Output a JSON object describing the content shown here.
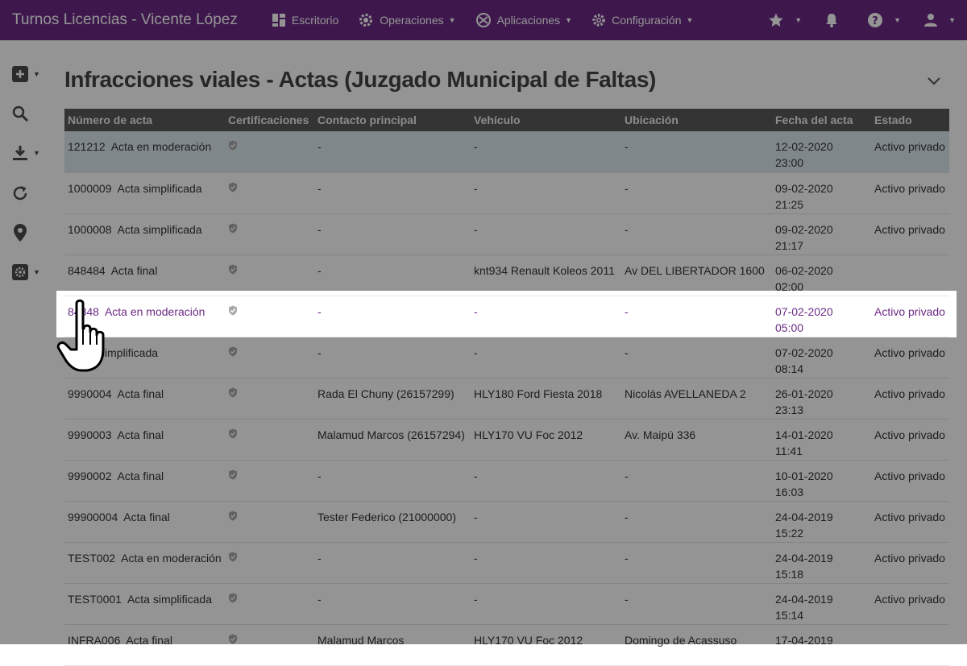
{
  "app": {
    "title": "Turnos Licencias - Vicente López",
    "nav": [
      {
        "label": "Escritorio",
        "icon": "dashboard-icon"
      },
      {
        "label": "Operaciones",
        "icon": "cog-operations-icon"
      },
      {
        "label": "Aplicaciones",
        "icon": "apps-icon"
      },
      {
        "label": "Configuración",
        "icon": "gear-icon"
      }
    ],
    "right_icons": [
      "star-icon",
      "bell-icon",
      "help-icon",
      "user-icon"
    ]
  },
  "sidebar_tools": [
    "add-icon",
    "search-icon",
    "download-icon",
    "refresh-icon",
    "location-pin-icon",
    "settings-icon"
  ],
  "page": {
    "title": "Infracciones viales - Actas (Juzgado Municipal de Faltas)"
  },
  "table": {
    "columns": [
      "Número de acta",
      "Certificaciones",
      "Contacto principal",
      "Vehículo",
      "Ubicación",
      "Fecha del acta",
      "Estado"
    ],
    "rows": [
      {
        "numero": "121212",
        "tipo": "Acta en moderación",
        "contacto": "-",
        "vehiculo": "-",
        "ubicacion": "-",
        "fecha": "12-02-2020",
        "hora": "23:00",
        "estado": "Activo privado"
      },
      {
        "numero": "1000009",
        "tipo": "Acta simplificada",
        "contacto": "-",
        "vehiculo": "-",
        "ubicacion": "-",
        "fecha": "09-02-2020",
        "hora": "21:25",
        "estado": "Activo privado"
      },
      {
        "numero": "1000008",
        "tipo": "Acta simplificada",
        "contacto": "-",
        "vehiculo": "-",
        "ubicacion": "-",
        "fecha": "09-02-2020",
        "hora": "21:17",
        "estado": "Activo privado"
      },
      {
        "numero": "848484",
        "tipo": "Acta final",
        "contacto": "-",
        "vehiculo": "knt934 Renault Koleos 2011",
        "ubicacion": "Av DEL LIBERTADOR 1600",
        "fecha": "06-02-2020",
        "hora": "02:00",
        "estado": ""
      },
      {
        "numero": "84848",
        "tipo": "Acta en moderación",
        "contacto": "-",
        "vehiculo": "-",
        "ubicacion": "-",
        "fecha": "07-02-2020",
        "hora": "05:00",
        "estado": "Activo privado"
      },
      {
        "numero": "",
        "tipo": "Acta simplificada",
        "contacto": "-",
        "vehiculo": "-",
        "ubicacion": "-",
        "fecha": "07-02-2020",
        "hora": "08:14",
        "estado": "Activo privado"
      },
      {
        "numero": "9990004",
        "tipo": "Acta final",
        "contacto": "Rada El Chuny (26157299)",
        "vehiculo": "HLY180 Ford Fiesta 2018",
        "ubicacion": "Nicolás AVELLANEDA 2",
        "fecha": "26-01-2020",
        "hora": "23:13",
        "estado": "Activo privado"
      },
      {
        "numero": "9990003",
        "tipo": "Acta final",
        "contacto": "Malamud Marcos (26157294)",
        "vehiculo": "HLY170 VU Foc 2012",
        "ubicacion": "Av. Maipú 336",
        "fecha": "14-01-2020",
        "hora": "11:41",
        "estado": "Activo privado"
      },
      {
        "numero": "9990002",
        "tipo": "Acta final",
        "contacto": "-",
        "vehiculo": "-",
        "ubicacion": "-",
        "fecha": "10-01-2020",
        "hora": "16:03",
        "estado": "Activo privado"
      },
      {
        "numero": "99900004",
        "tipo": "Acta final",
        "contacto": "Tester Federico (21000000)",
        "vehiculo": "-",
        "ubicacion": "-",
        "fecha": "24-04-2019",
        "hora": "15:22",
        "estado": "Activo privado"
      },
      {
        "numero": "TEST002",
        "tipo": "Acta en moderación",
        "contacto": "-",
        "vehiculo": "-",
        "ubicacion": "-",
        "fecha": "24-04-2019",
        "hora": "15:18",
        "estado": "Activo privado"
      },
      {
        "numero": "TEST0001",
        "tipo": "Acta simplificada",
        "contacto": "-",
        "vehiculo": "-",
        "ubicacion": "-",
        "fecha": "24-04-2019",
        "hora": "15:14",
        "estado": "Activo privado"
      },
      {
        "numero": "INFRA006",
        "tipo": "Acta final",
        "contacto": "Malamud Marcos",
        "vehiculo": "HLY170 VU Foc 2012",
        "ubicacion": "Domingo de Acassuso",
        "fecha": "17-04-2019",
        "hora": "",
        "estado": ""
      }
    ]
  },
  "colors": {
    "topbar": "#6c2a86",
    "table_header": "#5b5b5b",
    "selected_row": "#dce9ef",
    "overlay": "rgba(0,0,0,0.42)"
  }
}
